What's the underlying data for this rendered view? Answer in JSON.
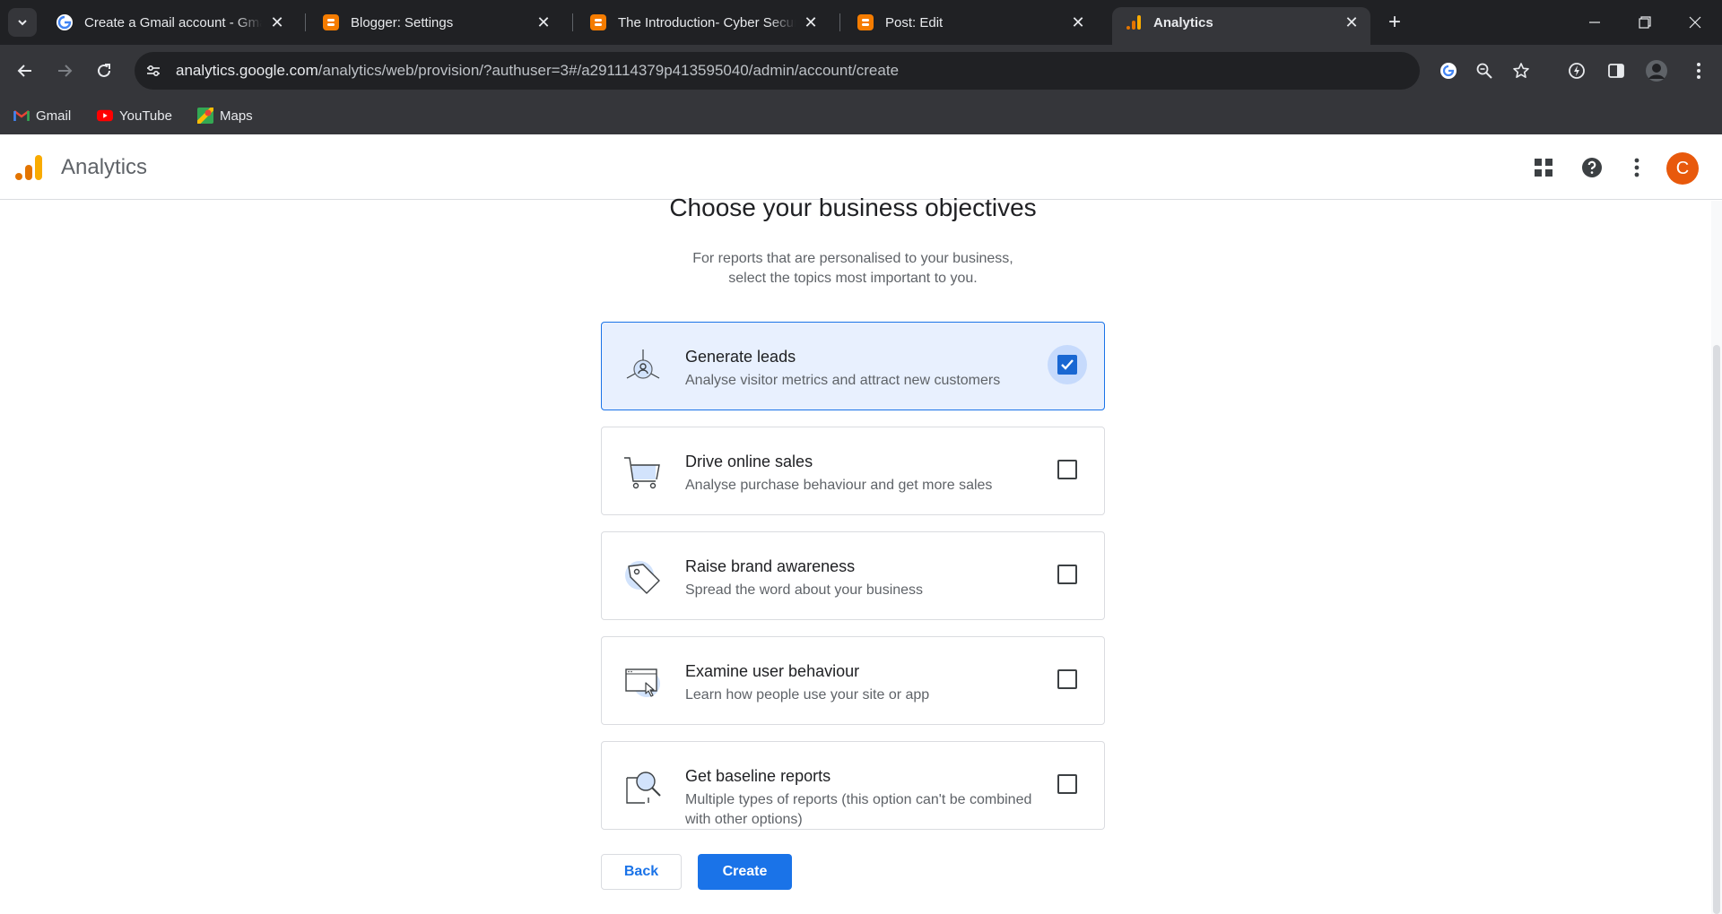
{
  "browser": {
    "tabs": [
      {
        "title": "Create a Gmail account - Gmail",
        "favicon": "google-g-icon",
        "active": false
      },
      {
        "title": "Blogger: Settings",
        "favicon": "blogger-icon",
        "active": false
      },
      {
        "title": "The Introduction- Cyber Security",
        "favicon": "blogger-icon",
        "active": false
      },
      {
        "title": "Post: Edit",
        "favicon": "blogger-icon",
        "active": false
      },
      {
        "title": "Analytics",
        "favicon": "analytics-icon",
        "active": true
      }
    ],
    "address": {
      "host": "analytics.google.com",
      "path": "/analytics/web/provision/?authuser=3#/a291114379p413595040/admin/account/create"
    },
    "bookmarks": [
      {
        "label": "Gmail",
        "icon": "gmail-icon"
      },
      {
        "label": "YouTube",
        "icon": "youtube-icon"
      },
      {
        "label": "Maps",
        "icon": "maps-icon"
      }
    ]
  },
  "app": {
    "name": "Analytics",
    "avatar_letter": "C",
    "colors": {
      "primary": "#1a73e8",
      "avatar": "#e8590c",
      "selected_card": "#e8f0fe"
    }
  },
  "page": {
    "heading": "Choose your business objectives",
    "subtext_line1": "For reports that are personalised to your business,",
    "subtext_line2": "select the topics most important to you.",
    "objectives": [
      {
        "title": "Generate leads",
        "description": "Analyse visitor metrics and attract new customers",
        "checked": true,
        "icon": "leads-target-icon"
      },
      {
        "title": "Drive online sales",
        "description": "Analyse purchase behaviour and get more sales",
        "checked": false,
        "icon": "shopping-cart-icon"
      },
      {
        "title": "Raise brand awareness",
        "description": "Spread the word about your business",
        "checked": false,
        "icon": "tag-icon"
      },
      {
        "title": "Examine user behaviour",
        "description": "Learn how people use your site or app",
        "checked": false,
        "icon": "browser-cursor-icon"
      },
      {
        "title": "Get baseline reports",
        "description": "Multiple types of reports (this option can't be combined with other options)",
        "checked": false,
        "icon": "magnifier-report-icon"
      }
    ],
    "back_label": "Back",
    "create_label": "Create"
  }
}
